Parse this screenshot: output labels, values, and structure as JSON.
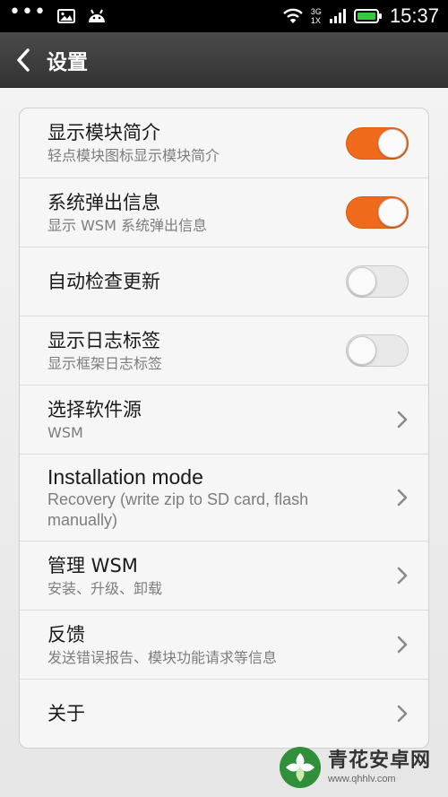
{
  "statusbar": {
    "time": "15:37",
    "network_type": "3G",
    "network_sub": "1X",
    "icons": [
      "more-dots-icon",
      "image-icon",
      "android-icon",
      "wifi-icon",
      "signal-icon",
      "battery-icon"
    ]
  },
  "header": {
    "title": "设置"
  },
  "settings": [
    {
      "title": "显示模块简介",
      "subtitle": "轻点模块图标显示模块简介",
      "control": "toggle",
      "on": true
    },
    {
      "title": "系统弹出信息",
      "subtitle": "显示 WSM 系统弹出信息",
      "control": "toggle",
      "on": true
    },
    {
      "title": "自动检查更新",
      "subtitle": "",
      "control": "toggle",
      "on": false
    },
    {
      "title": "显示日志标签",
      "subtitle": "显示框架日志标签",
      "control": "toggle",
      "on": false
    },
    {
      "title": "选择软件源",
      "subtitle": "WSM",
      "control": "chevron"
    },
    {
      "title": "Installation mode",
      "subtitle": "Recovery (write zip to SD card, flash manually)",
      "control": "chevron"
    },
    {
      "title": "管理 WSM",
      "subtitle": "安装、升级、卸载",
      "control": "chevron"
    },
    {
      "title": "反馈",
      "subtitle": "发送错误报告、模块功能请求等信息",
      "control": "chevron"
    },
    {
      "title": "关于",
      "subtitle": "",
      "control": "chevron"
    }
  ],
  "watermark": {
    "title": "青花安卓网",
    "url": "www.qhhlv.com"
  },
  "colors": {
    "accent": "#f06a1c",
    "titlebar": "#3d3d3d",
    "statusbar": "#000000"
  }
}
